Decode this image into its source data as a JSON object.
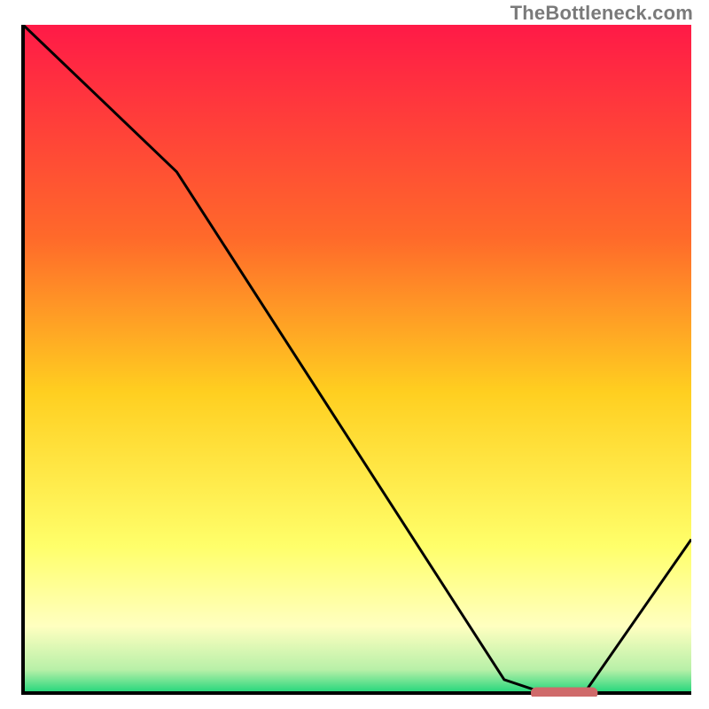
{
  "attribution": "TheBottleneck.com",
  "chart_data": {
    "type": "line",
    "title": "",
    "xlabel": "",
    "ylabel": "",
    "xlim": [
      0,
      100
    ],
    "ylim": [
      0,
      100
    ],
    "x": [
      0,
      23,
      72,
      78,
      84,
      100
    ],
    "values": [
      100,
      78,
      2,
      0,
      0,
      23
    ],
    "optimal_marker": {
      "x_start": 76,
      "x_end": 86,
      "y": 0
    },
    "gradient_stops": [
      {
        "pos": 0.0,
        "color": "#ff1a47"
      },
      {
        "pos": 0.32,
        "color": "#ff6a2a"
      },
      {
        "pos": 0.55,
        "color": "#ffcf20"
      },
      {
        "pos": 0.78,
        "color": "#ffff6a"
      },
      {
        "pos": 0.9,
        "color": "#ffffc0"
      },
      {
        "pos": 0.965,
        "color": "#b8f0a8"
      },
      {
        "pos": 1.0,
        "color": "#1fd67a"
      }
    ]
  }
}
